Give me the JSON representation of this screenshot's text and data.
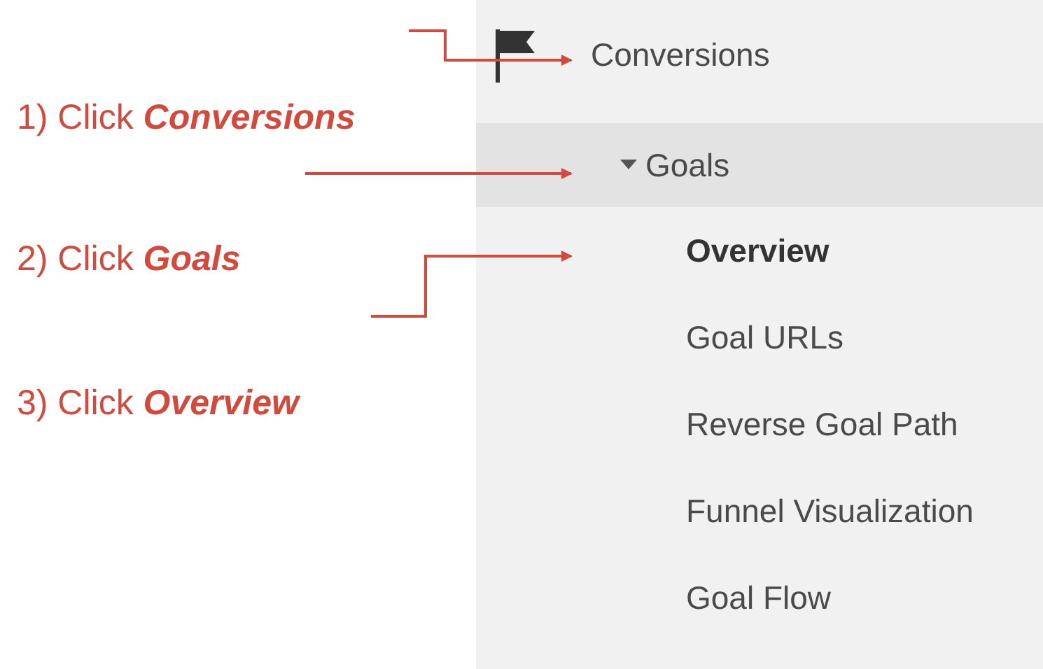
{
  "annotations": [
    {
      "text": "1) Click **Conversions**"
    },
    {
      "text": "2) Click **Goals**"
    },
    {
      "text": "3) Click **Overview**"
    }
  ],
  "sidebar": {
    "section": {
      "label": "Conversions"
    },
    "groups": [
      {
        "label": "Goals",
        "expanded": true,
        "selected": true,
        "children": [
          {
            "label": "Overview",
            "selected": true
          },
          {
            "label": "Goal URLs",
            "selected": false
          },
          {
            "label": "Reverse Goal Path",
            "selected": false
          },
          {
            "label": "Funnel Visualization",
            "selected": false
          },
          {
            "label": "Goal Flow",
            "selected": false
          }
        ]
      }
    ]
  }
}
